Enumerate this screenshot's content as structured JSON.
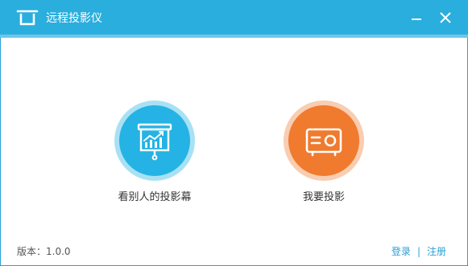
{
  "window": {
    "title": "远程投影仪"
  },
  "actions": {
    "view_others": {
      "label": "看别人的投影幕",
      "icon": "presentation-chart-icon",
      "color": "#24b3e4"
    },
    "project": {
      "label": "我要投影",
      "icon": "projector-icon",
      "color": "#f07a2e"
    }
  },
  "footer": {
    "version_label": "版本：1.0.0",
    "login_label": "登录",
    "separator": "|",
    "register_label": "注册"
  },
  "colors": {
    "accent": "#2aaedd",
    "link": "#2a9fd6"
  }
}
